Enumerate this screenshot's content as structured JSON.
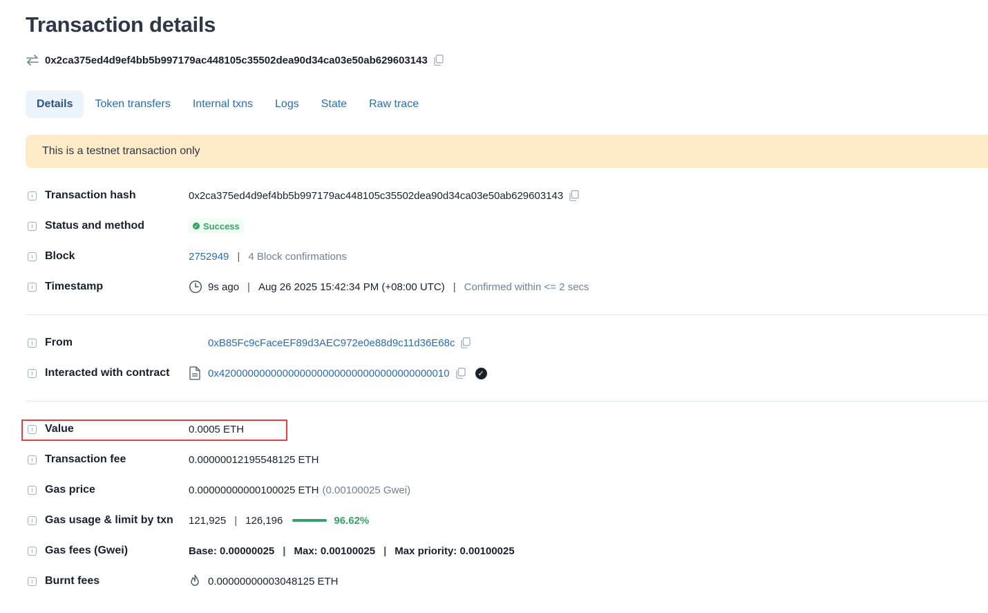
{
  "page": {
    "title": "Transaction details",
    "tx_hash": "0x2ca375ed4d9ef4bb5b997179ac448105c35502dea90d34ca03e50ab629603143"
  },
  "tabs": [
    "Details",
    "Token transfers",
    "Internal txns",
    "Logs",
    "State",
    "Raw trace"
  ],
  "banner": "This is a testnet transaction only",
  "fields": {
    "tx_hash": {
      "label": "Transaction hash",
      "value": "0x2ca375ed4d9ef4bb5b997179ac448105c35502dea90d34ca03e50ab629603143"
    },
    "status": {
      "label": "Status and method",
      "value": "Success"
    },
    "block": {
      "label": "Block",
      "number": "2752949",
      "confirmations": "4 Block confirmations"
    },
    "timestamp": {
      "label": "Timestamp",
      "ago": "9s ago",
      "datetime": "Aug 26 2025 15:42:34 PM (+08:00 UTC)",
      "confirmed": "Confirmed within <= 2 secs"
    },
    "from": {
      "label": "From",
      "address": "0xB85Fc9cFaceEF89d3AEC972e0e88d9c11d36E68c"
    },
    "contract": {
      "label": "Interacted with contract",
      "address": "0x4200000000000000000000000000000000000010"
    },
    "value": {
      "label": "Value",
      "value": "0.0005 ETH"
    },
    "fee": {
      "label": "Transaction fee",
      "value": "0.00000012195548125 ETH"
    },
    "gas_price": {
      "label": "Gas price",
      "value": "0.00000000000100025 ETH",
      "gwei": "(0.00100025 Gwei)"
    },
    "gas_usage": {
      "label": "Gas usage & limit by txn",
      "used": "121,925",
      "limit": "126,196",
      "percent": "96.62%",
      "fraction": 0.9662
    },
    "gas_fees": {
      "label": "Gas fees (Gwei)",
      "base": "Base: 0.00000025",
      "max": "Max: 0.00100025",
      "priority": "Max priority: 0.00100025"
    },
    "burnt": {
      "label": "Burnt fees",
      "value": "0.00000000003048125 ETH"
    }
  },
  "separator": "|",
  "colors": {
    "link": "#2b6cb0",
    "success": "#38a169",
    "banner": "#feebc8",
    "highlight": "#e53e3e"
  }
}
